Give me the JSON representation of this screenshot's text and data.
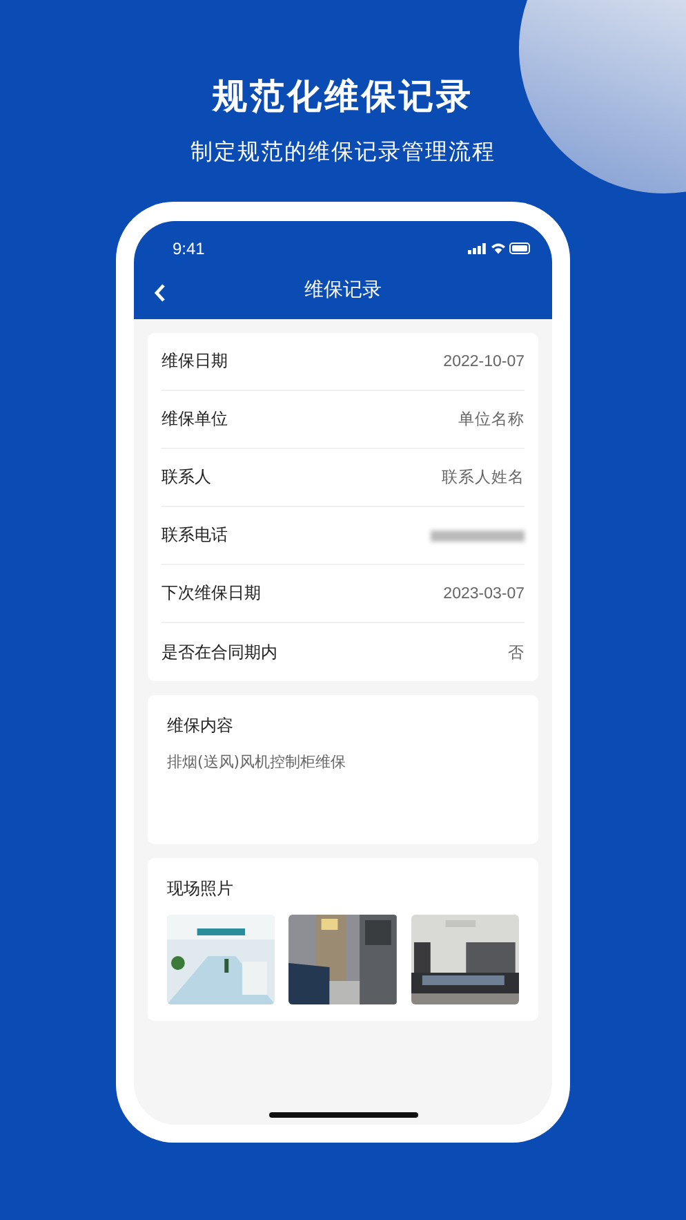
{
  "headline": "规范化维保记录",
  "subheadline": "制定规范的维保记录管理流程",
  "status_bar": {
    "time": "9:41"
  },
  "nav": {
    "title": "维保记录"
  },
  "fields": [
    {
      "kind": "text",
      "label": "维保日期",
      "value": "2022-10-07"
    },
    {
      "kind": "text",
      "label": "维保单位",
      "value": "单位名称"
    },
    {
      "kind": "text",
      "label": "联系人",
      "value": "联系人姓名"
    },
    {
      "kind": "blurred",
      "label": "联系电话"
    },
    {
      "kind": "text",
      "label": "下次维保日期",
      "value": "2023-03-07"
    },
    {
      "kind": "text",
      "label": "是否在合同期内",
      "value": "否"
    }
  ],
  "content": {
    "title": "维保内容",
    "text": "排烟(送风)风机控制柜维保"
  },
  "photos": {
    "title": "现场照片"
  }
}
